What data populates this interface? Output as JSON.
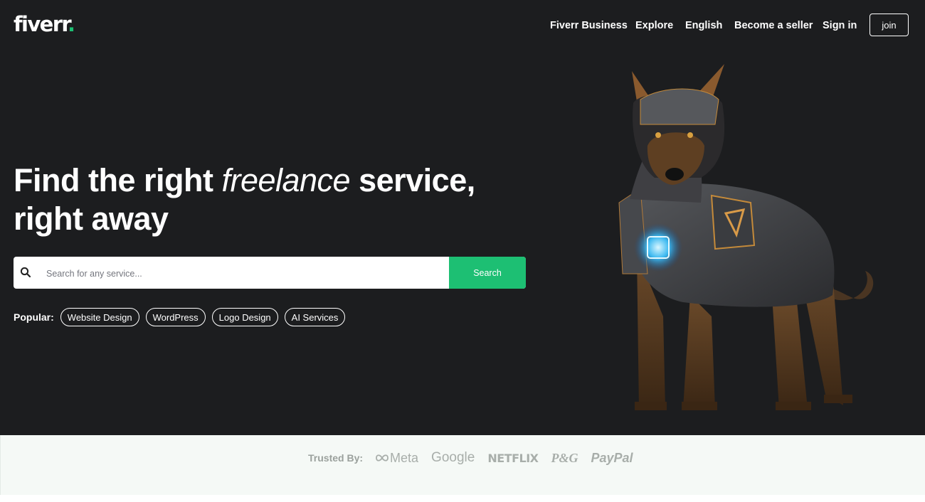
{
  "header": {
    "logo_text": "fiverr",
    "logo_dot": ".",
    "nav": [
      {
        "label": "Fiverr Business"
      },
      {
        "label": "Explore"
      },
      {
        "label": "English"
      },
      {
        "label": "Become a seller"
      },
      {
        "label": "Sign in"
      }
    ],
    "join_label": "join"
  },
  "hero": {
    "headline_part1": "Find the right ",
    "headline_italic": "freelance",
    "headline_part2": " service,",
    "headline_line2": "right away",
    "search": {
      "placeholder": "Search for any service...",
      "value": "",
      "button_label": "Search",
      "icon": "search-icon"
    },
    "popular_label": "Popular:",
    "popular_tags": [
      "Website Design",
      "WordPress",
      "Logo Design",
      "AI Services"
    ],
    "image": "robot-dog-illustration"
  },
  "trusted": {
    "label": "Trusted By:",
    "brands": [
      "Meta",
      "Google",
      "NETFLIX",
      "P&G",
      "PayPal"
    ]
  },
  "colors": {
    "hero_bg": "#1c1d1f",
    "accent": "#1dbf73",
    "trusted_bg": "#f5f9f6",
    "brand_gray": "#a8aeaa"
  }
}
